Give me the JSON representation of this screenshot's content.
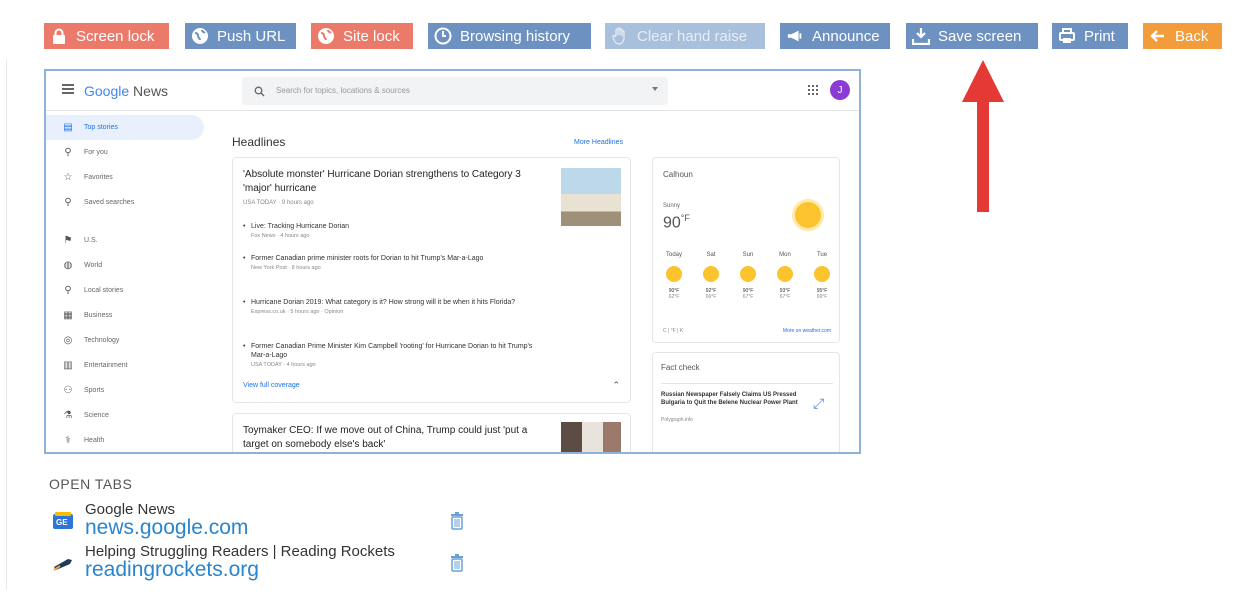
{
  "toolbar": {
    "buttons": [
      {
        "label": "Screen lock",
        "icon": "lock-icon",
        "color": "#ec7a6b"
      },
      {
        "label": "Push URL",
        "icon": "globe-icon",
        "color": "#6d92c1"
      },
      {
        "label": "Site lock",
        "icon": "globe-lock-icon",
        "color": "#ec7a6b"
      },
      {
        "label": "Browsing history",
        "icon": "clock-icon",
        "color": "#6d92c1"
      },
      {
        "label": "Clear hand raise",
        "icon": "hand-icon",
        "color": "#a9c0dc"
      },
      {
        "label": "Announce",
        "icon": "megaphone-icon",
        "color": "#6d92c1"
      },
      {
        "label": "Save screen",
        "icon": "download-icon",
        "color": "#6d92c1"
      },
      {
        "label": "Print",
        "icon": "printer-icon",
        "color": "#6d92c1"
      },
      {
        "label": "Back",
        "icon": "arrow-left-icon",
        "color": "#f29c3c"
      }
    ]
  },
  "screenshot": {
    "logo": {
      "google": "Google",
      "news": "News"
    },
    "search_placeholder": "Search for topics, locations & sources",
    "avatar_letter": "J",
    "sidebar": [
      {
        "label": "Top stories",
        "icon": "newspaper-icon"
      },
      {
        "label": "For you",
        "icon": "person-icon"
      },
      {
        "label": "Favorites",
        "icon": "star-icon"
      },
      {
        "label": "Saved searches",
        "icon": "search-icon"
      },
      {
        "label": "U.S.",
        "icon": "flag-icon"
      },
      {
        "label": "World",
        "icon": "globe-icon"
      },
      {
        "label": "Local stories",
        "icon": "pin-icon"
      },
      {
        "label": "Business",
        "icon": "building-icon"
      },
      {
        "label": "Technology",
        "icon": "chip-icon"
      },
      {
        "label": "Entertainment",
        "icon": "film-icon"
      },
      {
        "label": "Sports",
        "icon": "bike-icon"
      },
      {
        "label": "Science",
        "icon": "flask-icon"
      },
      {
        "label": "Health",
        "icon": "health-icon"
      }
    ],
    "headlines_title": "Headlines",
    "more_headlines": "More Headlines",
    "main_story": {
      "title": "'Absolute monster' Hurricane Dorian strengthens to Category 3 'major' hurricane",
      "source": "USA TODAY · 9 hours ago",
      "subs": [
        {
          "title": "Live: Tracking Hurricane Dorian",
          "source": "Fox News · 4 hours ago"
        },
        {
          "title": "Former Canadian prime minister roots for Dorian to hit Trump's Mar-a-Lago",
          "source": "New York Post · 8 hours ago"
        },
        {
          "title": "Hurricane Dorian 2019: What category is it? How strong will it be when it hits Florida?",
          "source": "Express.co.uk · 5 hours ago · Opinion"
        },
        {
          "title": "Former Canadian Prime Minister Kim Campbell 'rooting' for Hurricane Dorian to hit Trump's Mar-a-Lago",
          "source": "USA TODAY · 4 hours ago"
        }
      ],
      "full_coverage": "View full coverage"
    },
    "story2": {
      "title": "Toymaker CEO: If we move out of China, Trump could just 'put a target on somebody else's back'"
    },
    "weather": {
      "city": "Calhoun",
      "condition": "Sunny",
      "temp": "90",
      "unit": "°F",
      "days": [
        {
          "day": "Today",
          "hi": "90°F",
          "lo": "62°F"
        },
        {
          "day": "Sat",
          "hi": "92°F",
          "lo": "66°F"
        },
        {
          "day": "Sun",
          "hi": "90°F",
          "lo": "67°F"
        },
        {
          "day": "Mon",
          "hi": "93°F",
          "lo": "67°F"
        },
        {
          "day": "Tue",
          "hi": "95°F",
          "lo": "69°F"
        }
      ],
      "units_toggle": "C | °F | K",
      "more_link": "More on weather.com"
    },
    "fact_check": {
      "title": "Fact check",
      "headline": "Russian Newspaper Falsely Claims US Pressed Bulgaria to Quit the Belene Nuclear Power Plant",
      "source": "Polygraph.info"
    }
  },
  "open_tabs": {
    "title": "OPEN TABS",
    "tabs": [
      {
        "name": "Google News",
        "url": "news.google.com",
        "icon": "google-news-icon"
      },
      {
        "name": "Helping Struggling Readers | Reading Rockets",
        "url": "readingrockets.org",
        "icon": "reading-rockets-icon"
      }
    ]
  },
  "colors": {
    "annotation_arrow": "#e53935",
    "link": "#2a85cc"
  }
}
